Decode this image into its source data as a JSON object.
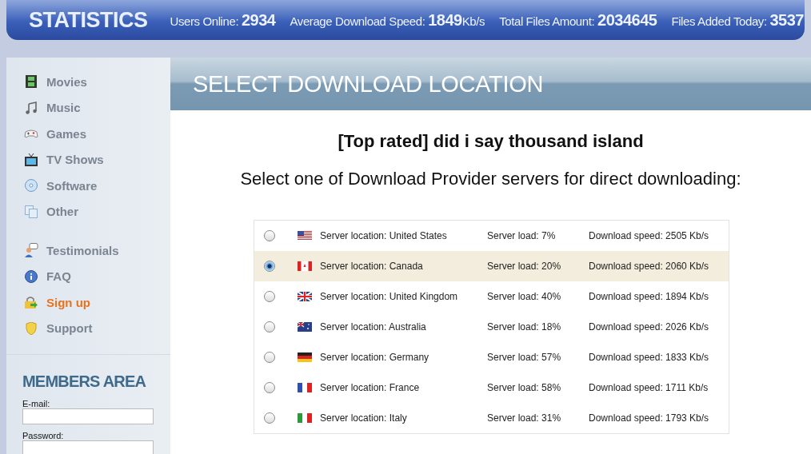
{
  "header": {
    "logo": "STATISTICS",
    "stats": [
      {
        "label": "Users Online:",
        "value": "2934"
      },
      {
        "label": "Average Download Speed:",
        "value": "1849",
        "unit": "Kb/s"
      },
      {
        "label": "Total Files Amount:",
        "value": "2034645"
      },
      {
        "label": "Files Added Today:",
        "value": "3537"
      }
    ]
  },
  "sidebar": {
    "groups": [
      {
        "items": [
          {
            "label": "Movies",
            "selected": false
          },
          {
            "label": "Music",
            "selected": false
          },
          {
            "label": "Games",
            "selected": false
          },
          {
            "label": "TV Shows",
            "selected": false
          },
          {
            "label": "Software",
            "selected": false
          },
          {
            "label": "Other",
            "selected": false
          }
        ]
      },
      {
        "items": [
          {
            "label": "Testimonials",
            "selected": false
          },
          {
            "label": "FAQ",
            "selected": false
          },
          {
            "label": "Sign up",
            "selected": true
          },
          {
            "label": "Support",
            "selected": false
          }
        ]
      }
    ],
    "members": {
      "title": "MEMBERS AREA",
      "fields": [
        {
          "label": "E-mail:"
        },
        {
          "label": "Password:"
        }
      ]
    }
  },
  "main": {
    "title": "SELECT DOWNLOAD LOCATION",
    "heading": "[Top rated] did i say thousand island",
    "subheading": "Select one of Download Provider servers for direct downloading:",
    "servers": [
      {
        "location": "Server location: United States",
        "load": "Server load: 7%",
        "speed": "Download speed: 2505 Kb/s",
        "selected": false
      },
      {
        "location": "Server location: Canada",
        "load": "Server load: 20%",
        "speed": "Download speed: 2060 Kb/s",
        "selected": true
      },
      {
        "location": "Server location: United Kingdom",
        "load": "Server load: 40%",
        "speed": "Download speed: 1894 Kb/s",
        "selected": false
      },
      {
        "location": "Server location: Australia",
        "load": "Server load: 18%",
        "speed": "Download speed: 2026 Kb/s",
        "selected": false
      },
      {
        "location": "Server location: Germany",
        "load": "Server load: 57%",
        "speed": "Download speed: 1833 Kb/s",
        "selected": false
      },
      {
        "location": "Server location: France",
        "load": "Server load: 58%",
        "speed": "Download speed: 1711 Kb/s",
        "selected": false
      },
      {
        "location": "Server location: Italy",
        "load": "Server load: 31%",
        "speed": "Download speed: 1793 Kb/s",
        "selected": false
      }
    ]
  }
}
